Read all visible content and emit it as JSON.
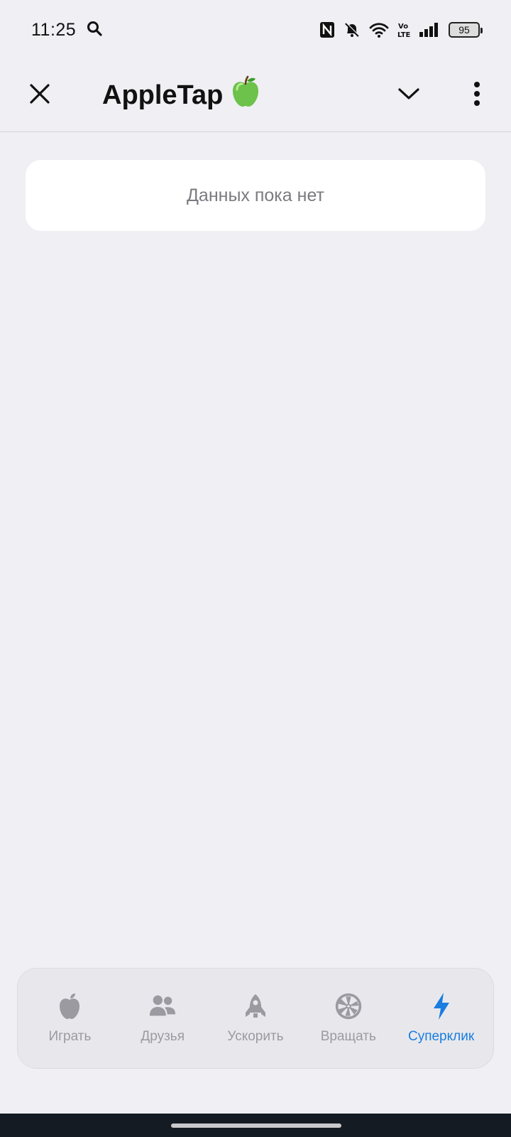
{
  "status_bar": {
    "time": "11:25",
    "battery": "95",
    "network": "LTE"
  },
  "header": {
    "title": "AppleTap",
    "title_emoji": "🍏"
  },
  "empty_state": {
    "text": "Данных пока нет"
  },
  "tabs": [
    {
      "label": "Играть",
      "icon": "apple-icon",
      "active": false
    },
    {
      "label": "Друзья",
      "icon": "friends-icon",
      "active": false
    },
    {
      "label": "Ускорить",
      "icon": "rocket-icon",
      "active": false
    },
    {
      "label": "Вращать",
      "icon": "wheel-icon",
      "active": false
    },
    {
      "label": "Суперклик",
      "icon": "lightning-icon",
      "active": true
    }
  ],
  "colors": {
    "accent": "#1a7de0",
    "inactive": "#9a9aa0",
    "background": "#efeff4"
  }
}
